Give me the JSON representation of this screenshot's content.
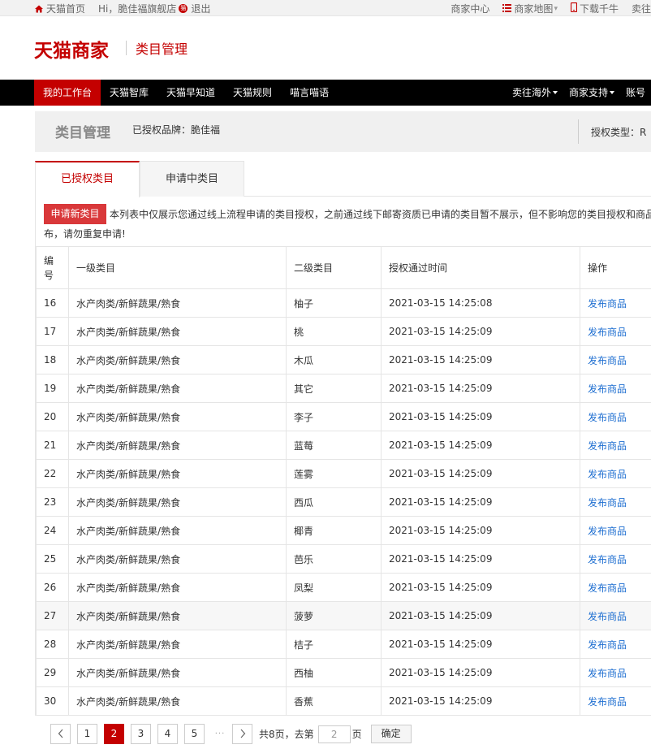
{
  "topbar": {
    "home": "天猫首页",
    "greeting": "Hi，脆佳福旗舰店",
    "logout": "退出",
    "seller_center": "商家中心",
    "site_map": "商家地图",
    "download": "下载千牛",
    "sell_more": "卖往"
  },
  "header": {
    "logo": "天猫商家",
    "title": "类目管理"
  },
  "nav": {
    "left": [
      "我的工作台",
      "天猫智库",
      "天猫早知道",
      "天猫规则",
      "喵言喵语"
    ],
    "right": [
      "卖往海外",
      "商家支持",
      "账号"
    ]
  },
  "pagehead": {
    "title": "类目管理",
    "brand": "已授权品牌：脆佳福",
    "auth_type": "授权类型：R"
  },
  "tabs": [
    "已授权类目",
    "申请中类目"
  ],
  "notice": {
    "button": "申请新类目",
    "line1": "本列表中仅展示您通过线上流程申请的类目授权，之前通过线下邮寄资质已申请的类目暂不展示，但不影响您的类目授权和商品",
    "line2": "布，请勿重复申请!"
  },
  "table": {
    "headers": [
      "编号",
      "一级类目",
      "二级类目",
      "授权通过时间",
      "操作"
    ],
    "rows": [
      [
        "16",
        "水产肉类/新鲜蔬果/熟食",
        "柚子",
        "2021-03-15 14:25:08",
        "发布商品"
      ],
      [
        "17",
        "水产肉类/新鲜蔬果/熟食",
        "桃",
        "2021-03-15 14:25:09",
        "发布商品"
      ],
      [
        "18",
        "水产肉类/新鲜蔬果/熟食",
        "木瓜",
        "2021-03-15 14:25:09",
        "发布商品"
      ],
      [
        "19",
        "水产肉类/新鲜蔬果/熟食",
        "其它",
        "2021-03-15 14:25:09",
        "发布商品"
      ],
      [
        "20",
        "水产肉类/新鲜蔬果/熟食",
        "李子",
        "2021-03-15 14:25:09",
        "发布商品"
      ],
      [
        "21",
        "水产肉类/新鲜蔬果/熟食",
        "蓝莓",
        "2021-03-15 14:25:09",
        "发布商品"
      ],
      [
        "22",
        "水产肉类/新鲜蔬果/熟食",
        "莲雾",
        "2021-03-15 14:25:09",
        "发布商品"
      ],
      [
        "23",
        "水产肉类/新鲜蔬果/熟食",
        "西瓜",
        "2021-03-15 14:25:09",
        "发布商品"
      ],
      [
        "24",
        "水产肉类/新鲜蔬果/熟食",
        "椰青",
        "2021-03-15 14:25:09",
        "发布商品"
      ],
      [
        "25",
        "水产肉类/新鲜蔬果/熟食",
        "芭乐",
        "2021-03-15 14:25:09",
        "发布商品"
      ],
      [
        "26",
        "水产肉类/新鲜蔬果/熟食",
        "凤梨",
        "2021-03-15 14:25:09",
        "发布商品"
      ],
      [
        "27",
        "水产肉类/新鲜蔬果/熟食",
        "菠萝",
        "2021-03-15 14:25:09",
        "发布商品"
      ],
      [
        "28",
        "水产肉类/新鲜蔬果/熟食",
        "桔子",
        "2021-03-15 14:25:09",
        "发布商品"
      ],
      [
        "29",
        "水产肉类/新鲜蔬果/熟食",
        "西柚",
        "2021-03-15 14:25:09",
        "发布商品"
      ],
      [
        "30",
        "水产肉类/新鲜蔬果/熟食",
        "香蕉",
        "2021-03-15 14:25:09",
        "发布商品"
      ]
    ]
  },
  "pager": {
    "pages": [
      "1",
      "2",
      "3",
      "4",
      "5"
    ],
    "current": "2",
    "ellipsis": "···",
    "total_text": "共8页，去第",
    "page_unit": "页",
    "goto_value": "2",
    "confirm": "确定"
  },
  "colors": {
    "brand_red": "#c40000",
    "link_blue": "#1f6fd1",
    "nav_black": "#000000"
  }
}
